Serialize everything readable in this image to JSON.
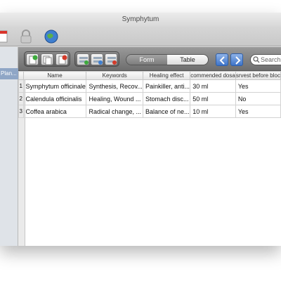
{
  "window": {
    "title": "Symphytum"
  },
  "sidebar": {
    "items": [
      {
        "label": "Plan..."
      }
    ]
  },
  "view_switch": {
    "form_label": "Form",
    "table_label": "Table"
  },
  "search": {
    "placeholder": "Search"
  },
  "table": {
    "columns": [
      "Name",
      "Keywords",
      "Healing effect",
      "commended dosa",
      "srvest before bloc"
    ],
    "rows": [
      {
        "num": "1",
        "cells": [
          "Symphytum officinale",
          "Synthesis, Recov...",
          "Painkiller, anti...",
          "30 ml",
          "Yes"
        ]
      },
      {
        "num": "2",
        "cells": [
          "Calendula officinalis",
          "Healing, Wound ...",
          "Stomach disc...",
          "50 ml",
          "No"
        ]
      },
      {
        "num": "3",
        "cells": [
          "Coffea arabica",
          "Radical change, ...",
          "Balance of ne...",
          "10 ml",
          "Yes"
        ]
      }
    ]
  }
}
